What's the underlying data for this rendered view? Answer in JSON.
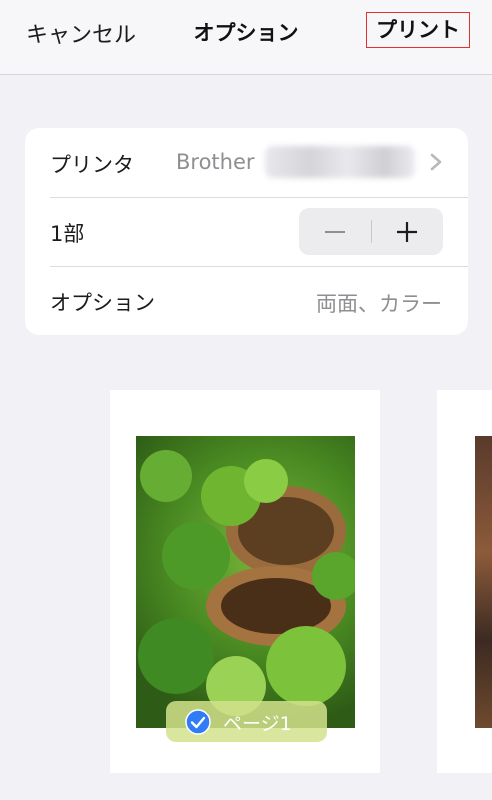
{
  "navbar": {
    "cancel": "キャンセル",
    "title": "オプション",
    "print": "プリント"
  },
  "settings": {
    "printer": {
      "label": "プリンタ",
      "value": "Brother"
    },
    "copies": {
      "label": "1部"
    },
    "options": {
      "label": "オプション",
      "value": "両面、カラー"
    }
  },
  "preview": {
    "page_label": "ページ1"
  },
  "colors": {
    "accent": "#2f7cf6",
    "highlight_border": "#e0322f"
  }
}
